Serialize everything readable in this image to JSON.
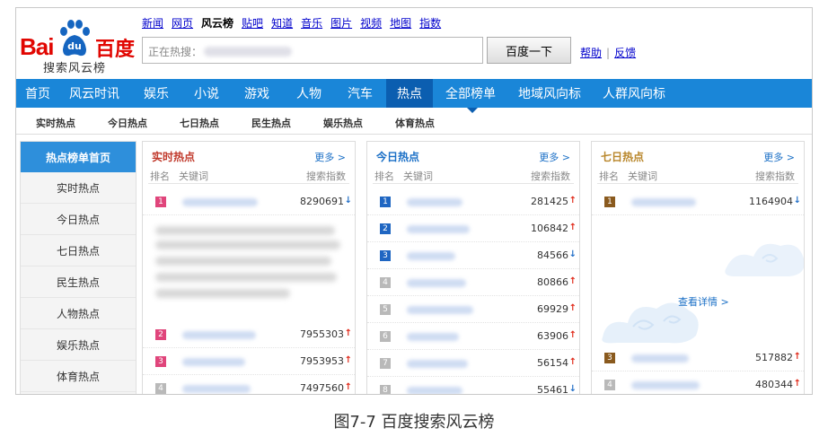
{
  "logo": {
    "bai": "Bai",
    "du": "百度",
    "paw_text": "du",
    "subtitle": "搜索风云榜"
  },
  "topnav": [
    {
      "label": "新闻",
      "active": false
    },
    {
      "label": "网页",
      "active": false
    },
    {
      "label": "风云榜",
      "active": true
    },
    {
      "label": "贴吧",
      "active": false
    },
    {
      "label": "知道",
      "active": false
    },
    {
      "label": "音乐",
      "active": false
    },
    {
      "label": "图片",
      "active": false
    },
    {
      "label": "视频",
      "active": false
    },
    {
      "label": "地图",
      "active": false
    },
    {
      "label": "指数",
      "active": false
    }
  ],
  "search": {
    "label": "正在热搜：",
    "button": "百度一下"
  },
  "help": {
    "help": "帮助",
    "sep": "|",
    "feedback": "反馈"
  },
  "mainnav": {
    "items": [
      "首页",
      "风云时讯",
      "娱乐",
      "小说",
      "游戏",
      "人物",
      "汽车",
      "热点",
      "全部榜单",
      "地域风向标",
      "人群风向标"
    ],
    "active_index": 7
  },
  "subnav": [
    "实时热点",
    "今日热点",
    "七日热点",
    "民生热点",
    "娱乐热点",
    "体育热点"
  ],
  "sidebar": {
    "head": "热点榜单首页",
    "items": [
      "实时热点",
      "今日热点",
      "七日热点",
      "民生热点",
      "人物热点",
      "娱乐热点",
      "体育热点"
    ]
  },
  "colors": {
    "nav_blue": "#1a86d8",
    "nav_active": "#0b5eb0",
    "up": "#e02a1a",
    "down": "#2470c8",
    "rank_pink": "#e0457b",
    "rank_blue": "#1f66c2",
    "rank_gray": "#b9b9b9",
    "rank_brown": "#8a5a1e"
  },
  "panels": {
    "realtime": {
      "title": "实时热点",
      "more": "更多 >",
      "col_rank": "排名",
      "col_kw": "关键词",
      "col_idx": "搜索指数",
      "top": {
        "rank": "1",
        "value": "8290691",
        "trend": "down"
      },
      "rows": [
        {
          "rank": "2",
          "value": "7955303",
          "trend": "up"
        },
        {
          "rank": "3",
          "value": "7953953",
          "trend": "up"
        },
        {
          "rank": "4",
          "value": "7497560",
          "trend": "up"
        }
      ]
    },
    "today": {
      "title": "今日热点",
      "more": "更多 >",
      "col_rank": "排名",
      "col_kw": "关键词",
      "col_idx": "搜索指数",
      "rows": [
        {
          "rank": "1",
          "value": "281425",
          "trend": "up"
        },
        {
          "rank": "2",
          "value": "106842",
          "trend": "up"
        },
        {
          "rank": "3",
          "value": "84566",
          "trend": "down"
        },
        {
          "rank": "4",
          "value": "80866",
          "trend": "up"
        },
        {
          "rank": "5",
          "value": "69929",
          "trend": "up"
        },
        {
          "rank": "6",
          "value": "63906",
          "trend": "up"
        },
        {
          "rank": "7",
          "value": "56154",
          "trend": "up"
        },
        {
          "rank": "8",
          "value": "55461",
          "trend": "down"
        }
      ]
    },
    "week": {
      "title": "七日热点",
      "more": "更多 >",
      "col_rank": "排名",
      "col_kw": "关键词",
      "col_idx": "搜索指数",
      "top": {
        "rank": "1",
        "value": "1164904",
        "trend": "down"
      },
      "detail": "查看详情 >",
      "rows": [
        {
          "rank": "3",
          "value": "517882",
          "trend": "up"
        },
        {
          "rank": "4",
          "value": "480344",
          "trend": "up"
        }
      ]
    }
  },
  "caption": "图7-7  百度搜索风云榜"
}
